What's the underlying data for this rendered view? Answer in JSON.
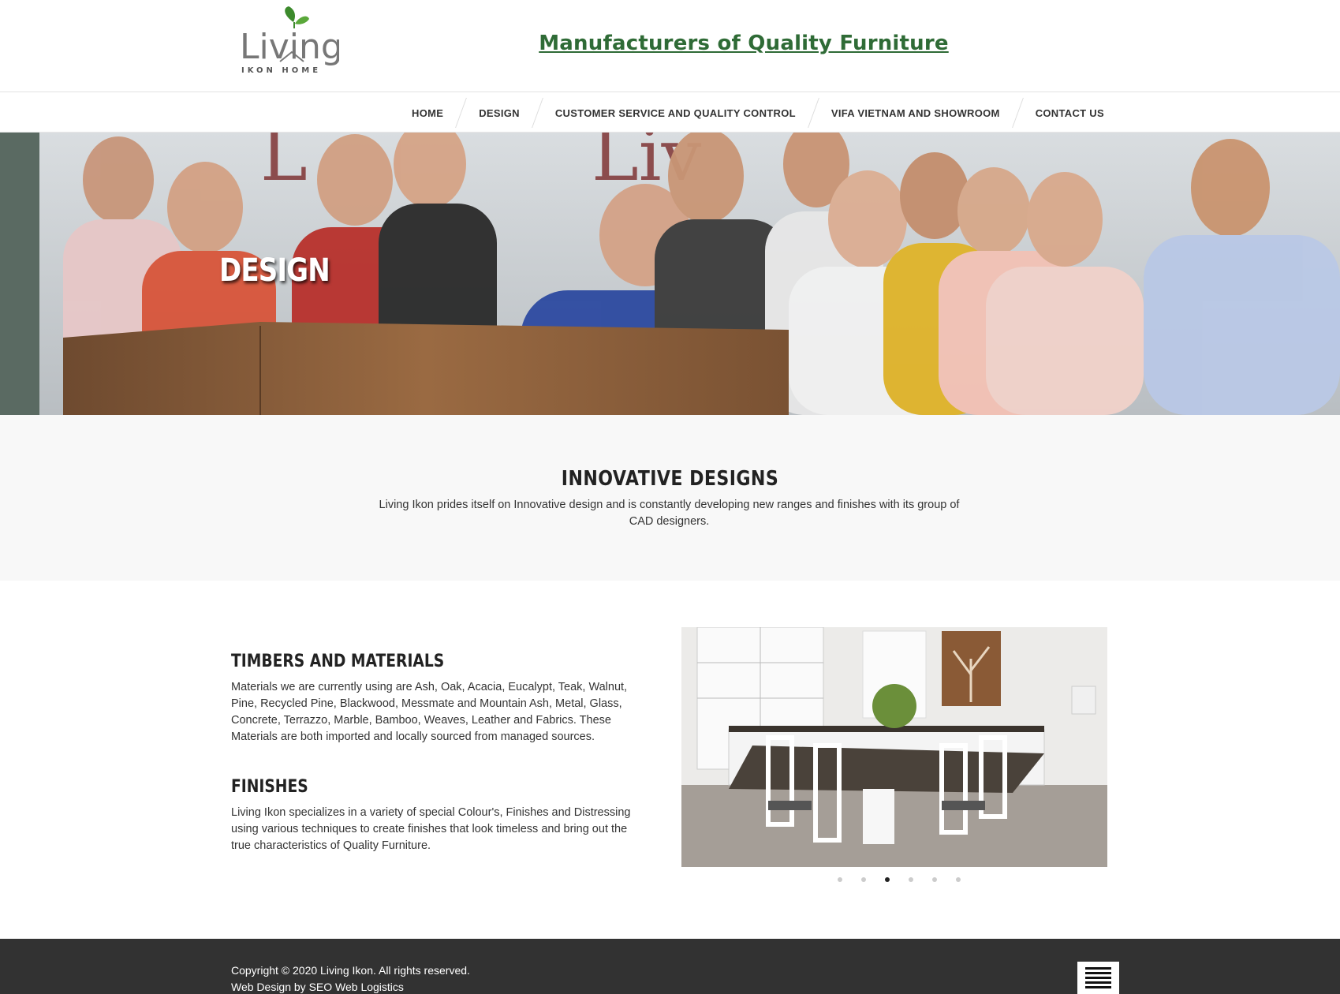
{
  "header": {
    "logo_text": "Living",
    "logo_subtext": "IKON HOME",
    "tagline": "Manufacturers of Quality Furniture"
  },
  "nav": {
    "items": [
      {
        "label": "HOME"
      },
      {
        "label": "DESIGN"
      },
      {
        "label": "CUSTOMER SERVICE AND QUALITY CONTROL"
      },
      {
        "label": "VIFA VIETNAM AND SHOWROOM"
      },
      {
        "label": "CONTACT US"
      }
    ]
  },
  "hero": {
    "title": "DESIGN"
  },
  "intro": {
    "heading": "INNOVATIVE DESIGNS",
    "text": "Living Ikon prides itself on Innovative design and is constantly developing new ranges and finishes with its group of CAD designers."
  },
  "content": {
    "timbers_heading": "TIMBERS AND MATERIALS",
    "timbers_text": "Materials we are currently using are Ash, Oak, Acacia, Eucalypt, Teak, Walnut, Pine, Recycled Pine, Blackwood, Messmate and Mountain Ash, Metal, Glass, Concrete, Terrazzo, Marble, Bamboo, Weaves, Leather and Fabrics. These Materials are both imported and locally sourced from managed sources.",
    "finishes_heading": "FINISHES",
    "finishes_text": "Living Ikon specializes in a variety of special Colour's, Finishes and Distressing using various techniques to create finishes that look timeless and bring out the true characteristics of Quality Furniture.",
    "slider": {
      "slide_count": 6,
      "active_slide": 3
    }
  },
  "footer": {
    "copyright": "Copyright © 2020 Living Ikon. All rights reserved.",
    "credit": "Web Design by SEO Web Logistics"
  },
  "colors": {
    "tagline": "#2f6b36",
    "logo_leaf": "#4a8f2e",
    "footer_bg": "#323232",
    "intro_bg": "#f8f8f8"
  }
}
